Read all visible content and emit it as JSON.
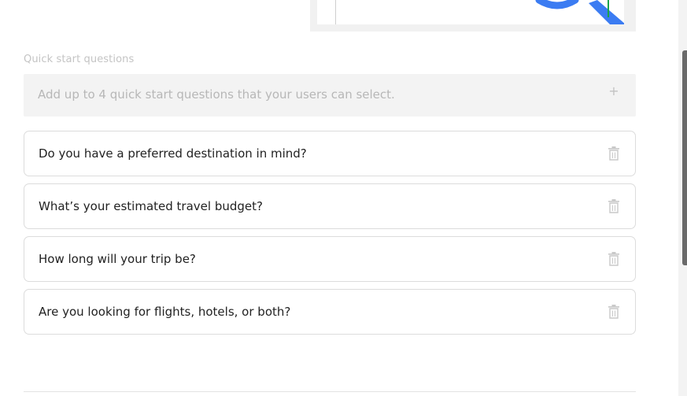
{
  "quick_start": {
    "label": "Quick start questions",
    "add_placeholder": "Add up to 4 quick start questions that your users can select.",
    "add_icon": "plus-icon",
    "questions": [
      {
        "text": "Do you have a preferred destination in mind?",
        "icon": "trash-icon"
      },
      {
        "text": "What’s your estimated travel budget?",
        "icon": "trash-icon"
      },
      {
        "text": "How long will your trip be?",
        "icon": "trash-icon"
      },
      {
        "text": "Are you looking for flights, hotels, or both?",
        "icon": "trash-icon"
      }
    ]
  },
  "colors": {
    "accent_blue": "#3b7cf2",
    "accent_green": "#1aa34a",
    "text_primary": "#222222",
    "text_muted": "#b7b7b7"
  }
}
